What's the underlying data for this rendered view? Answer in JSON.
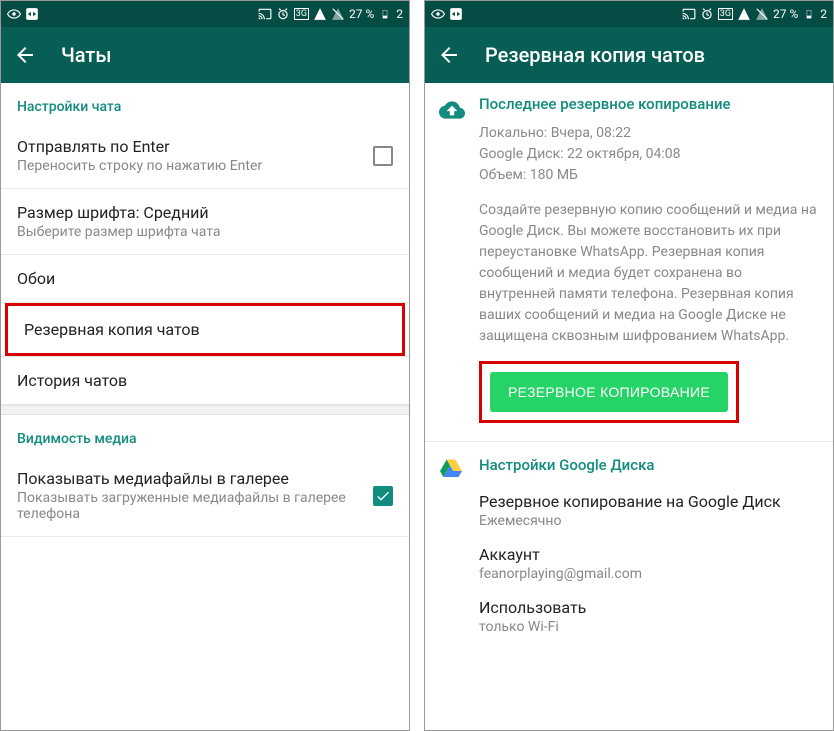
{
  "statusbar": {
    "battery_percent": "27 %",
    "time_prefix": "2"
  },
  "left": {
    "title": "Чаты",
    "section1": "Настройки чата",
    "send_enter_title": "Отправлять по Enter",
    "send_enter_sub": "Переносить строку по нажатию Enter",
    "font_title": "Размер шрифта: Средний",
    "font_sub": "Выберите размер шрифта чата",
    "wallpaper": "Обои",
    "backup": "Резервная копия чатов",
    "history": "История чатов",
    "section2": "Видимость медиа",
    "media_title": "Показывать медиафайлы в галерее",
    "media_sub": "Показывать загруженные медиафайлы в галерее телефона"
  },
  "right": {
    "title": "Резервная копия чатов",
    "last_backup": "Последнее резервное копирование",
    "meta_local": "Локально: Вчера, 08:22",
    "meta_gdrive": "Google Диск: 22 октября, 04:08",
    "meta_size": "Объем: 180 МБ",
    "desc": "Создайте резервную копию сообщений и медиа на Google Диск. Вы можете восстановить их при переустановке WhatsApp. Резервная копия сообщений и медиа будет сохранена во внутренней памяти телефона. Резервная копия ваших сообщений и медиа на Google Диске не защищена сквозным шифрованием WhatsApp.",
    "backup_button": "РЕЗЕРВНОЕ КОПИРОВАНИЕ",
    "gdrive_settings": "Настройки Google Диска",
    "freq_label": "Резервное копирование на Google Диск",
    "freq_value": "Ежемесячно",
    "account_label": "Аккаунт",
    "account_value": "feanorplaying@gmail.com",
    "use_label": "Использовать",
    "use_value": "только Wi-Fi"
  }
}
